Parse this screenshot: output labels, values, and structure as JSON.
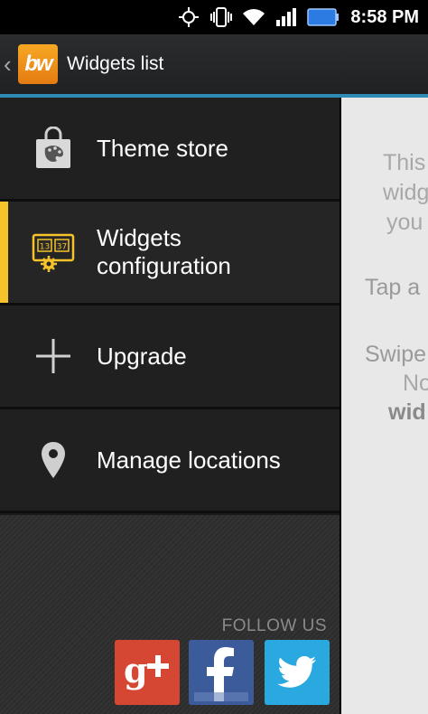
{
  "status_bar": {
    "time": "8:58 PM",
    "icons": [
      "gps-icon",
      "vibrate-icon",
      "wifi-icon",
      "signal-icon",
      "battery-icon"
    ]
  },
  "action_bar": {
    "title": "Widgets list",
    "logo_text": "bw"
  },
  "drawer": {
    "items": [
      {
        "label": "Theme store",
        "icon": "shopping-bag-palette-icon",
        "active": false
      },
      {
        "label": "Widgets configuration",
        "label_lines": [
          "Widgets",
          "configuration"
        ],
        "icon": "clock-gear-icon",
        "active": true
      },
      {
        "label": "Upgrade",
        "icon": "plus-icon",
        "active": false
      },
      {
        "label": "Manage locations",
        "icon": "location-pin-icon",
        "active": false
      }
    ],
    "follow_us": "FOLLOW US",
    "social": [
      {
        "name": "google-plus",
        "label": "g+"
      },
      {
        "name": "facebook",
        "label": "f"
      },
      {
        "name": "twitter",
        "label": "twitter"
      }
    ]
  },
  "content": {
    "lines": [
      "This",
      "widg",
      "you",
      "Tap a",
      "Swipe",
      "No",
      "wid"
    ]
  },
  "colors": {
    "accent_line": "#2f8bb3",
    "active_indicator": "#f6c32a",
    "logo": "#f0951c"
  }
}
